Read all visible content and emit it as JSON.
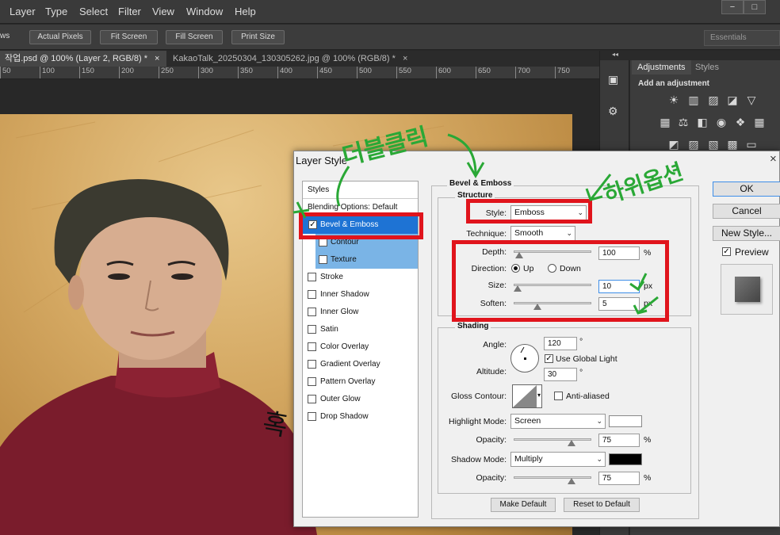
{
  "menu": [
    "Layer",
    "Type",
    "Select",
    "Filter",
    "View",
    "Window",
    "Help"
  ],
  "window_controls": {
    "minimize": "−",
    "maximize": "□"
  },
  "options_bar": {
    "partial_label": "ws",
    "buttons": [
      "Actual Pixels",
      "Fit Screen",
      "Fill Screen",
      "Print Size"
    ],
    "workspace": "Essentials"
  },
  "tabs": [
    {
      "label": "작업.psd @ 100% (Layer 2, RGB/8) *",
      "close": "×"
    },
    {
      "label": "KakaoTalk_20250304_130305262.jpg @ 100% (RGB/8) *",
      "close": "×"
    }
  ],
  "ruler": [
    "50",
    "100",
    "150",
    "200",
    "250",
    "300",
    "350",
    "400",
    "450",
    "500",
    "550",
    "600",
    "650",
    "700",
    "750"
  ],
  "panels": {
    "collapse": "◂◂",
    "tabs": [
      "Adjustments",
      "Styles"
    ],
    "heading": "Add an adjustment"
  },
  "dialog": {
    "title": "Layer Style",
    "close": "×",
    "styles_header": "Styles",
    "styles": [
      {
        "label": "Blending Options: Default",
        "checkbox": false,
        "checked": false
      },
      {
        "label": "Bevel & Emboss",
        "checkbox": true,
        "checked": true
      },
      {
        "label": "Contour",
        "checkbox": true,
        "checked": false
      },
      {
        "label": "Texture",
        "checkbox": true,
        "checked": false
      },
      {
        "label": "Stroke",
        "checkbox": true,
        "checked": false
      },
      {
        "label": "Inner Shadow",
        "checkbox": true,
        "checked": false
      },
      {
        "label": "Inner Glow",
        "checkbox": true,
        "checked": false
      },
      {
        "label": "Satin",
        "checkbox": true,
        "checked": false
      },
      {
        "label": "Color Overlay",
        "checkbox": true,
        "checked": false
      },
      {
        "label": "Gradient Overlay",
        "checkbox": true,
        "checked": false
      },
      {
        "label": "Pattern Overlay",
        "checkbox": true,
        "checked": false
      },
      {
        "label": "Outer Glow",
        "checkbox": true,
        "checked": false
      },
      {
        "label": "Drop Shadow",
        "checkbox": true,
        "checked": false
      }
    ],
    "section_title": "Bevel & Emboss",
    "structure": {
      "title": "Structure",
      "style_label": "Style:",
      "style_value": "Emboss",
      "technique_label": "Technique:",
      "technique_value": "Smooth",
      "depth_label": "Depth:",
      "depth_value": "100",
      "depth_unit": "%",
      "depth_level": 0.06,
      "direction_label": "Direction:",
      "dir_up": "Up",
      "dir_down": "Down",
      "direction_selected": "Up",
      "size_label": "Size:",
      "size_value": "10",
      "size_unit": "px",
      "size_level": 0.04,
      "soften_label": "Soften:",
      "soften_value": "5",
      "soften_unit": "px",
      "soften_level": 0.3
    },
    "shading": {
      "title": "Shading",
      "angle_label": "Angle:",
      "angle_value": "120",
      "angle_unit": "°",
      "use_global_light": "Use Global Light",
      "use_global_light_checked": true,
      "altitude_label": "Altitude:",
      "altitude_value": "30",
      "altitude_unit": "°",
      "gloss_label": "Gloss Contour:",
      "anti_aliased": "Anti-aliased",
      "anti_aliased_checked": false,
      "highlight_label": "Highlight Mode:",
      "highlight_value": "Screen",
      "highlight_color": "#ffffff",
      "hl_opacity_label": "Opacity:",
      "hl_opacity_value": "75",
      "hl_opacity_unit": "%",
      "hl_opacity_level": 0.75,
      "shadow_label": "Shadow Mode:",
      "shadow_value": "Multiply",
      "shadow_color": "#000000",
      "sh_opacity_label": "Opacity:",
      "sh_opacity_value": "75",
      "sh_opacity_unit": "%",
      "sh_opacity_level": 0.75
    },
    "make_default": "Make Default",
    "reset_default": "Reset to Default",
    "ok": "OK",
    "cancel": "Cancel",
    "new_style": "New Style...",
    "preview": "Preview",
    "preview_checked": true
  },
  "annotations": {
    "double_click": "더블클릭",
    "options_note": "하위옵션",
    "side_note": "혹"
  },
  "colors": {
    "highlight_red": "#e0141c",
    "selection_blue": "#1e73d4",
    "sub_item_blue": "#7ab4e6",
    "annotation_green": "#2aa836"
  }
}
